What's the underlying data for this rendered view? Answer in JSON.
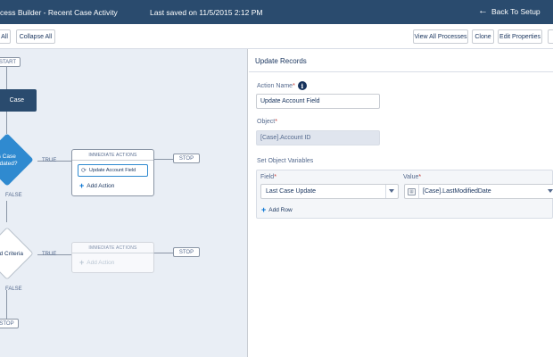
{
  "header": {
    "title": "cess Builder - Recent Case Activity",
    "saved": "Last saved on 11/5/2015 2:12 PM",
    "back_label": "Back To Setup",
    "back_icon": "arrow-left-icon"
  },
  "toolbar": {
    "expand_all": "All",
    "collapse_all": "Collapse All",
    "view_all": "View All Processes",
    "clone": "Clone",
    "edit_properties": "Edit Properties"
  },
  "canvas": {
    "start": "START",
    "object_node": "Case",
    "criteria1_line1": "s Case",
    "criteria1_line2": "pdated?",
    "criteria2": "dd Criteria",
    "true_label": "TRUE",
    "false_label": "FALSE",
    "stop": "STOP",
    "immediate_actions": "IMMEDIATE ACTIONS",
    "action_item": "Update Account Field",
    "add_action": "Add Action"
  },
  "panel": {
    "title": "Update Records",
    "action_name_label": "Action Name",
    "action_name_value": "Update Account Field",
    "object_label": "Object",
    "object_value": "[Case].Account ID",
    "set_vars_label": "Set Object Variables",
    "field_label": "Field",
    "value_label": "Value",
    "field_value": "Last Case Update",
    "value_value": "[Case].LastModifiedDate",
    "add_row": "Add Row"
  },
  "colors": {
    "header_bg": "#2a4b6e",
    "accent": "#2f8ad0",
    "canvas_bg": "#e9eef5",
    "required": "#c23934"
  }
}
